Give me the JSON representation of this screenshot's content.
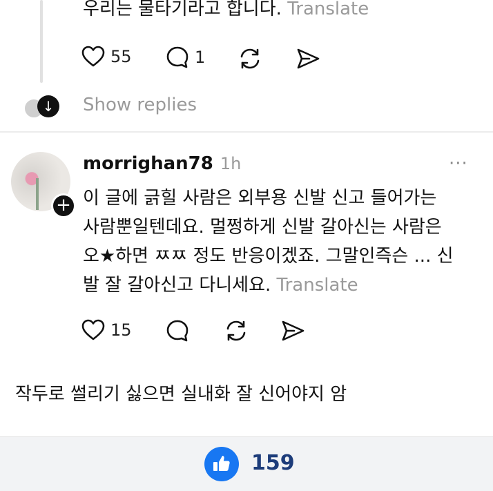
{
  "thread_top": {
    "text_tail": "우리는 물타기라고 합니다.",
    "translate_label": "Translate",
    "likes": "55",
    "replies": "1",
    "show_replies_label": "Show replies"
  },
  "comment": {
    "username": "morrighan78",
    "time": "1h",
    "more_label": "···",
    "lines": [
      "이 글에 긁힐 사람은 외부용 신발 신고 들어가는",
      "사람뿐일텐데요. 멀쩡하게 신발 갈아신는 사람은",
      "오★하면 ㅉㅉ 정도 반응이겠죠. 그말인즉슨 ... 신",
      "발 잘 갈아신고 다니세요."
    ],
    "translate_label": "Translate",
    "likes": "15"
  },
  "caption": "작두로 썰리기 싫으면 실내화 잘 신어야지 암",
  "bottom": {
    "like_count": "159"
  },
  "colors": {
    "like_button": "#1877f2",
    "like_count": "#1d3c7a",
    "muted_text": "#9a9a9a"
  }
}
